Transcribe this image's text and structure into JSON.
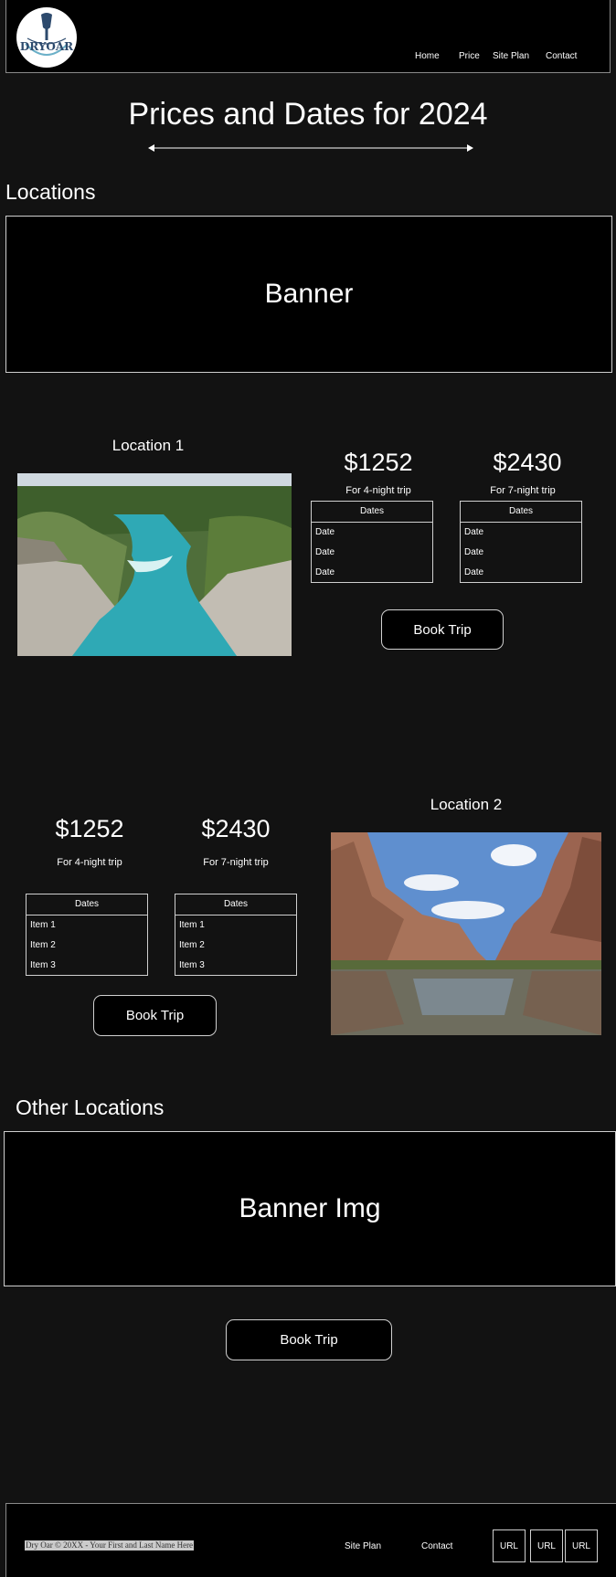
{
  "header": {
    "logo_text": "DRYOAR",
    "nav": [
      "Home",
      "Price",
      "Site Plan",
      "Contact"
    ]
  },
  "page": {
    "title": "Prices and Dates for 2024"
  },
  "locations": {
    "heading": "Locations",
    "banner_label": "Banner"
  },
  "location1": {
    "label": "Location 1",
    "image_alt": "Turquoise river flowing through a rocky, forested gorge",
    "plans": [
      {
        "price": "$1252",
        "sub": "For 4-night trip",
        "dates_header": "Dates",
        "rows": [
          "Date",
          "Date",
          "Date"
        ]
      },
      {
        "price": "$2430",
        "sub": "For 7-night trip",
        "dates_header": "Dates",
        "rows": [
          "Date",
          "Date",
          "Date"
        ]
      }
    ],
    "book_label": "Book Trip"
  },
  "location2": {
    "label": "Location 2",
    "image_alt": "Calm river between red canyon walls under a blue sky",
    "plans": [
      {
        "price": "$1252",
        "sub": "For 4-night trip",
        "dates_header": "Dates",
        "rows": [
          "Item 1",
          "Item 2",
          "Item 3"
        ]
      },
      {
        "price": "$2430",
        "sub": "For 7-night trip",
        "dates_header": "Dates",
        "rows": [
          "Item 1",
          "Item 2",
          "Item 3"
        ]
      }
    ],
    "book_label": "Book Trip"
  },
  "other": {
    "heading": "Other Locations",
    "banner_label": "Banner Img",
    "book_label": "Book Trip"
  },
  "footer": {
    "copyright": "Dry Oar © 20XX - Your First and Last Name Here",
    "links": [
      "Site Plan",
      "Contact"
    ],
    "url_buttons": [
      "URL",
      "URL",
      "URL"
    ]
  }
}
